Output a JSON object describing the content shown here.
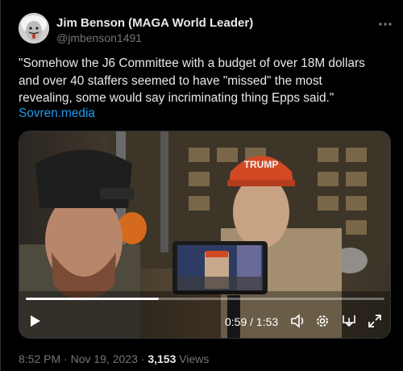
{
  "user": {
    "display_name": "Jim Benson (MAGA World Leader)",
    "handle": "@jmbenson1491",
    "avatar_icon": "einstein-avatar"
  },
  "tweet": {
    "text_lines": [
      "\"Somehow the J6 Committee with a budget of over 18M dollars",
      "and over 40 staffers seemed to have \"missed\" the most",
      "revealing, some would say incriminating thing  Epps said.\""
    ],
    "link_text": "Sovren.media"
  },
  "video": {
    "hat_text": "TRUMP",
    "progress_fraction": 0.37,
    "time_current": "0:59",
    "time_separator": " / ",
    "time_total": "1:53",
    "icons": [
      "play-icon",
      "volume-icon",
      "settings-gear-icon",
      "dock-icon",
      "fullscreen-icon"
    ]
  },
  "meta": {
    "time": "8:52 PM",
    "separator": " · ",
    "date": "Nov 19, 2023",
    "views_count": "3,153",
    "views_label": " Views"
  },
  "colors": {
    "background": "#000000",
    "text": "#e7e9ea",
    "secondary": "#71767b",
    "link": "#1d9bf0"
  }
}
